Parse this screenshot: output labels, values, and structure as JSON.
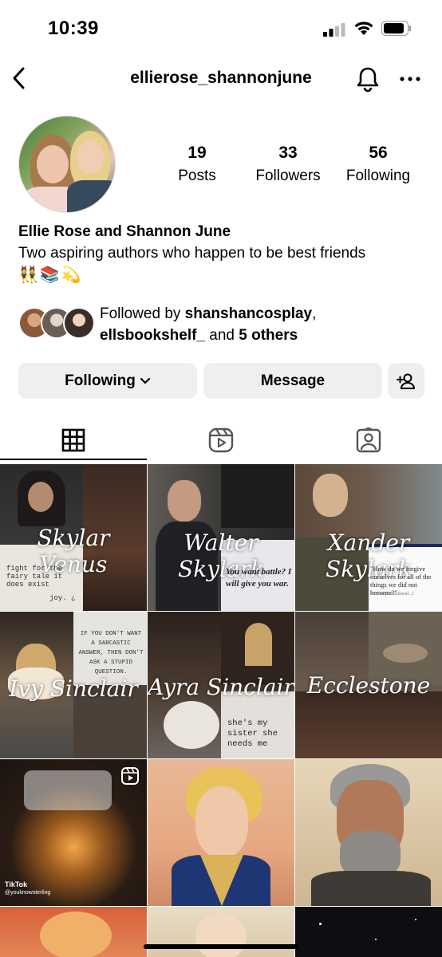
{
  "status_bar": {
    "time": "10:39"
  },
  "header": {
    "username": "ellierose_shannonjune"
  },
  "profile": {
    "posts_count": "19",
    "posts_label": "Posts",
    "followers_count": "33",
    "followers_label": "Followers",
    "following_count": "56",
    "following_label": "Following",
    "display_name": "Ellie Rose and Shannon June",
    "bio": "Two aspiring authors who happen to be best friends",
    "bio_emojis": "👯📚💫"
  },
  "followed_by": {
    "prefix": "Followed by ",
    "user1": "shanshancosplay",
    "sep": ",",
    "user2": "ellsbookshelf_",
    "and": " and ",
    "others": "5 others"
  },
  "buttons": {
    "following": "Following",
    "message": "Message"
  },
  "grid": {
    "posts": [
      {
        "caption": "Skylar Venus",
        "quote": "fight for the fairy tale it does exist",
        "signature": "joy. ¿"
      },
      {
        "caption": "Walter Skylark",
        "quote": "You want battle? I will give you war."
      },
      {
        "caption": "Xander Skylark",
        "quote": "\"How do we forgive ourselves for all of the things we did not become?\"",
        "quote_credit": "— (via yoinkedread...)"
      },
      {
        "caption": "Ivy Sinclair",
        "quote": "IF YOU DON'T WANT A SARCASTIC ANSWER, THEN DON'T ASK A STUPID QUESTION."
      },
      {
        "caption": "Ayra Sinclair",
        "quote": "she's my sister she needs me"
      },
      {
        "caption": "Ecclestone"
      },
      {
        "caption": "",
        "tiktok_label": "TikTok",
        "tiktok_user": "@youknowsterling"
      },
      {
        "caption": ""
      },
      {
        "caption": ""
      }
    ]
  },
  "colors": {
    "button_bg": "#efefef",
    "text": "#000000"
  }
}
